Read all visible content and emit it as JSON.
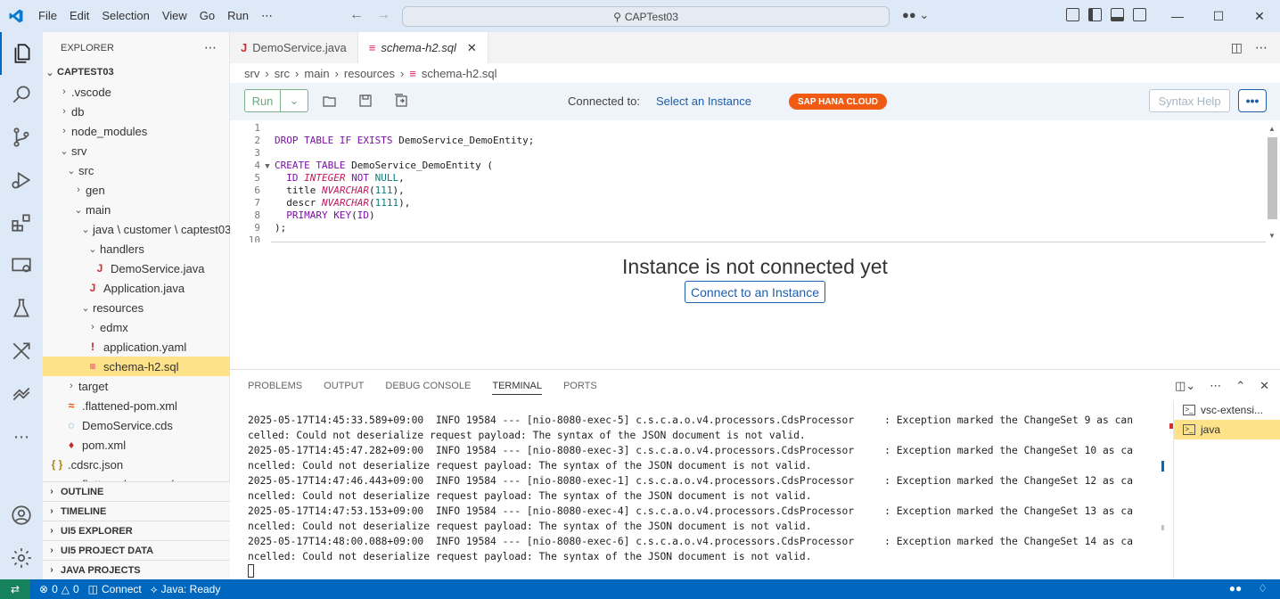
{
  "titlebar": {
    "menu": [
      "File",
      "Edit",
      "Selection",
      "View",
      "Go",
      "Run",
      "⋯"
    ],
    "search": "CAPTest03"
  },
  "sidebar": {
    "title": "EXPLORER",
    "more": "⋯",
    "root": "CAPTEST03",
    "tree": [
      {
        "label": ".vscode",
        "chev": "›",
        "icon": "",
        "color": ""
      },
      {
        "label": "db",
        "chev": "›",
        "icon": "",
        "color": ""
      },
      {
        "label": "node_modules",
        "chev": "›",
        "icon": "",
        "color": ""
      },
      {
        "label": "srv",
        "chev": "⌄",
        "icon": "",
        "color": ""
      },
      {
        "label": "src",
        "chev": "⌄",
        "icon": "",
        "color": ""
      },
      {
        "label": "gen",
        "chev": "›",
        "icon": "",
        "color": ""
      },
      {
        "label": "main",
        "chev": "⌄",
        "icon": "",
        "color": ""
      },
      {
        "label": "java \\ customer \\ captest03",
        "chev": "⌄",
        "icon": "",
        "color": ""
      },
      {
        "label": "handlers",
        "chev": "⌄",
        "icon": "",
        "color": ""
      },
      {
        "label": "DemoService.java",
        "chev": "",
        "icon": "J",
        "color": "#d32f2f"
      },
      {
        "label": "Application.java",
        "chev": "",
        "icon": "J",
        "color": "#d32f2f"
      },
      {
        "label": "resources",
        "chev": "⌄",
        "icon": "",
        "color": ""
      },
      {
        "label": "edmx",
        "chev": "›",
        "icon": "",
        "color": ""
      },
      {
        "label": "application.yaml",
        "chev": "",
        "icon": "!",
        "color": "#b71c1c"
      },
      {
        "label": "schema-h2.sql",
        "chev": "",
        "icon": "≡",
        "color": "#e0245e"
      },
      {
        "label": "target",
        "chev": "›",
        "icon": "",
        "color": ""
      },
      {
        "label": ".flattened-pom.xml",
        "chev": "",
        "icon": "≈",
        "color": "#e65100"
      },
      {
        "label": "DemoService.cds",
        "chev": "",
        "icon": "◌",
        "color": "#0a84b4"
      },
      {
        "label": "pom.xml",
        "chev": "",
        "icon": "♦",
        "color": "#c62828"
      },
      {
        "label": ".cdsrc.json",
        "chev": "",
        "icon": "{ }",
        "color": "#b8860b"
      },
      {
        "label": "flattened-pom.xml",
        "chev": "",
        "icon": "",
        "color": ""
      }
    ],
    "sections": [
      "OUTLINE",
      "TIMELINE",
      "UI5 EXPLORER",
      "UI5 PROJECT DATA",
      "JAVA PROJECTS"
    ]
  },
  "tabs": [
    {
      "label": "DemoService.java",
      "icon": "J"
    },
    {
      "label": "schema-h2.sql",
      "icon": "≡",
      "close": "✕"
    }
  ],
  "breadcrumb": [
    "srv",
    "src",
    "main",
    "resources",
    "schema-h2.sql"
  ],
  "breadcrumb_sep": "›",
  "sqltoolbar": {
    "run": "Run",
    "connected_to": "Connected to:",
    "select_instance": "Select an Instance",
    "badge": "SAP HANA CLOUD",
    "syntax_help": "Syntax Help",
    "more": "•••"
  },
  "code": {
    "line_numbers": [
      "1",
      "2",
      "3",
      "4",
      "5",
      "6",
      "7",
      "8",
      "9",
      "10"
    ]
  },
  "instance": {
    "message": "Instance is not connected yet",
    "button": "Connect to an Instance"
  },
  "panel": {
    "tabs": [
      "PROBLEMS",
      "OUTPUT",
      "DEBUG CONSOLE",
      "TERMINAL",
      "PORTS"
    ],
    "active_tab": "TERMINAL",
    "terminal_lines": [
      "2025-05-17T14:45:33.589+09:00  INFO 19584 --- [nio-8080-exec-5] c.s.c.a.o.v4.processors.CdsProcessor     : Exception marked the ChangeSet 9 as can",
      "celled: Could not deserialize request payload: The syntax of the JSON document is not valid.",
      "2025-05-17T14:45:47.282+09:00  INFO 19584 --- [nio-8080-exec-3] c.s.c.a.o.v4.processors.CdsProcessor     : Exception marked the ChangeSet 10 as ca",
      "ncelled: Could not deserialize request payload: The syntax of the JSON document is not valid.",
      "2025-05-17T14:47:46.443+09:00  INFO 19584 --- [nio-8080-exec-1] c.s.c.a.o.v4.processors.CdsProcessor     : Exception marked the ChangeSet 12 as ca",
      "ncelled: Could not deserialize request payload: The syntax of the JSON document is not valid.",
      "2025-05-17T14:47:53.153+09:00  INFO 19584 --- [nio-8080-exec-4] c.s.c.a.o.v4.processors.CdsProcessor     : Exception marked the ChangeSet 13 as ca",
      "ncelled: Could not deserialize request payload: The syntax of the JSON document is not valid.",
      "2025-05-17T14:48:00.088+09:00  INFO 19584 --- [nio-8080-exec-6] c.s.c.a.o.v4.processors.CdsProcessor     : Exception marked the ChangeSet 14 as ca",
      "ncelled: Could not deserialize request payload: The syntax of the JSON document is not valid."
    ],
    "terminals": [
      "vsc-extensi...",
      "java"
    ]
  },
  "statusbar": {
    "errors": "0",
    "warnings": "0",
    "connect": "Connect",
    "java": "Java: Ready"
  },
  "colors": {
    "accent": "#0067bf",
    "badge": "#f05a13",
    "selection": "#fde28a",
    "remote": "#16825d"
  }
}
